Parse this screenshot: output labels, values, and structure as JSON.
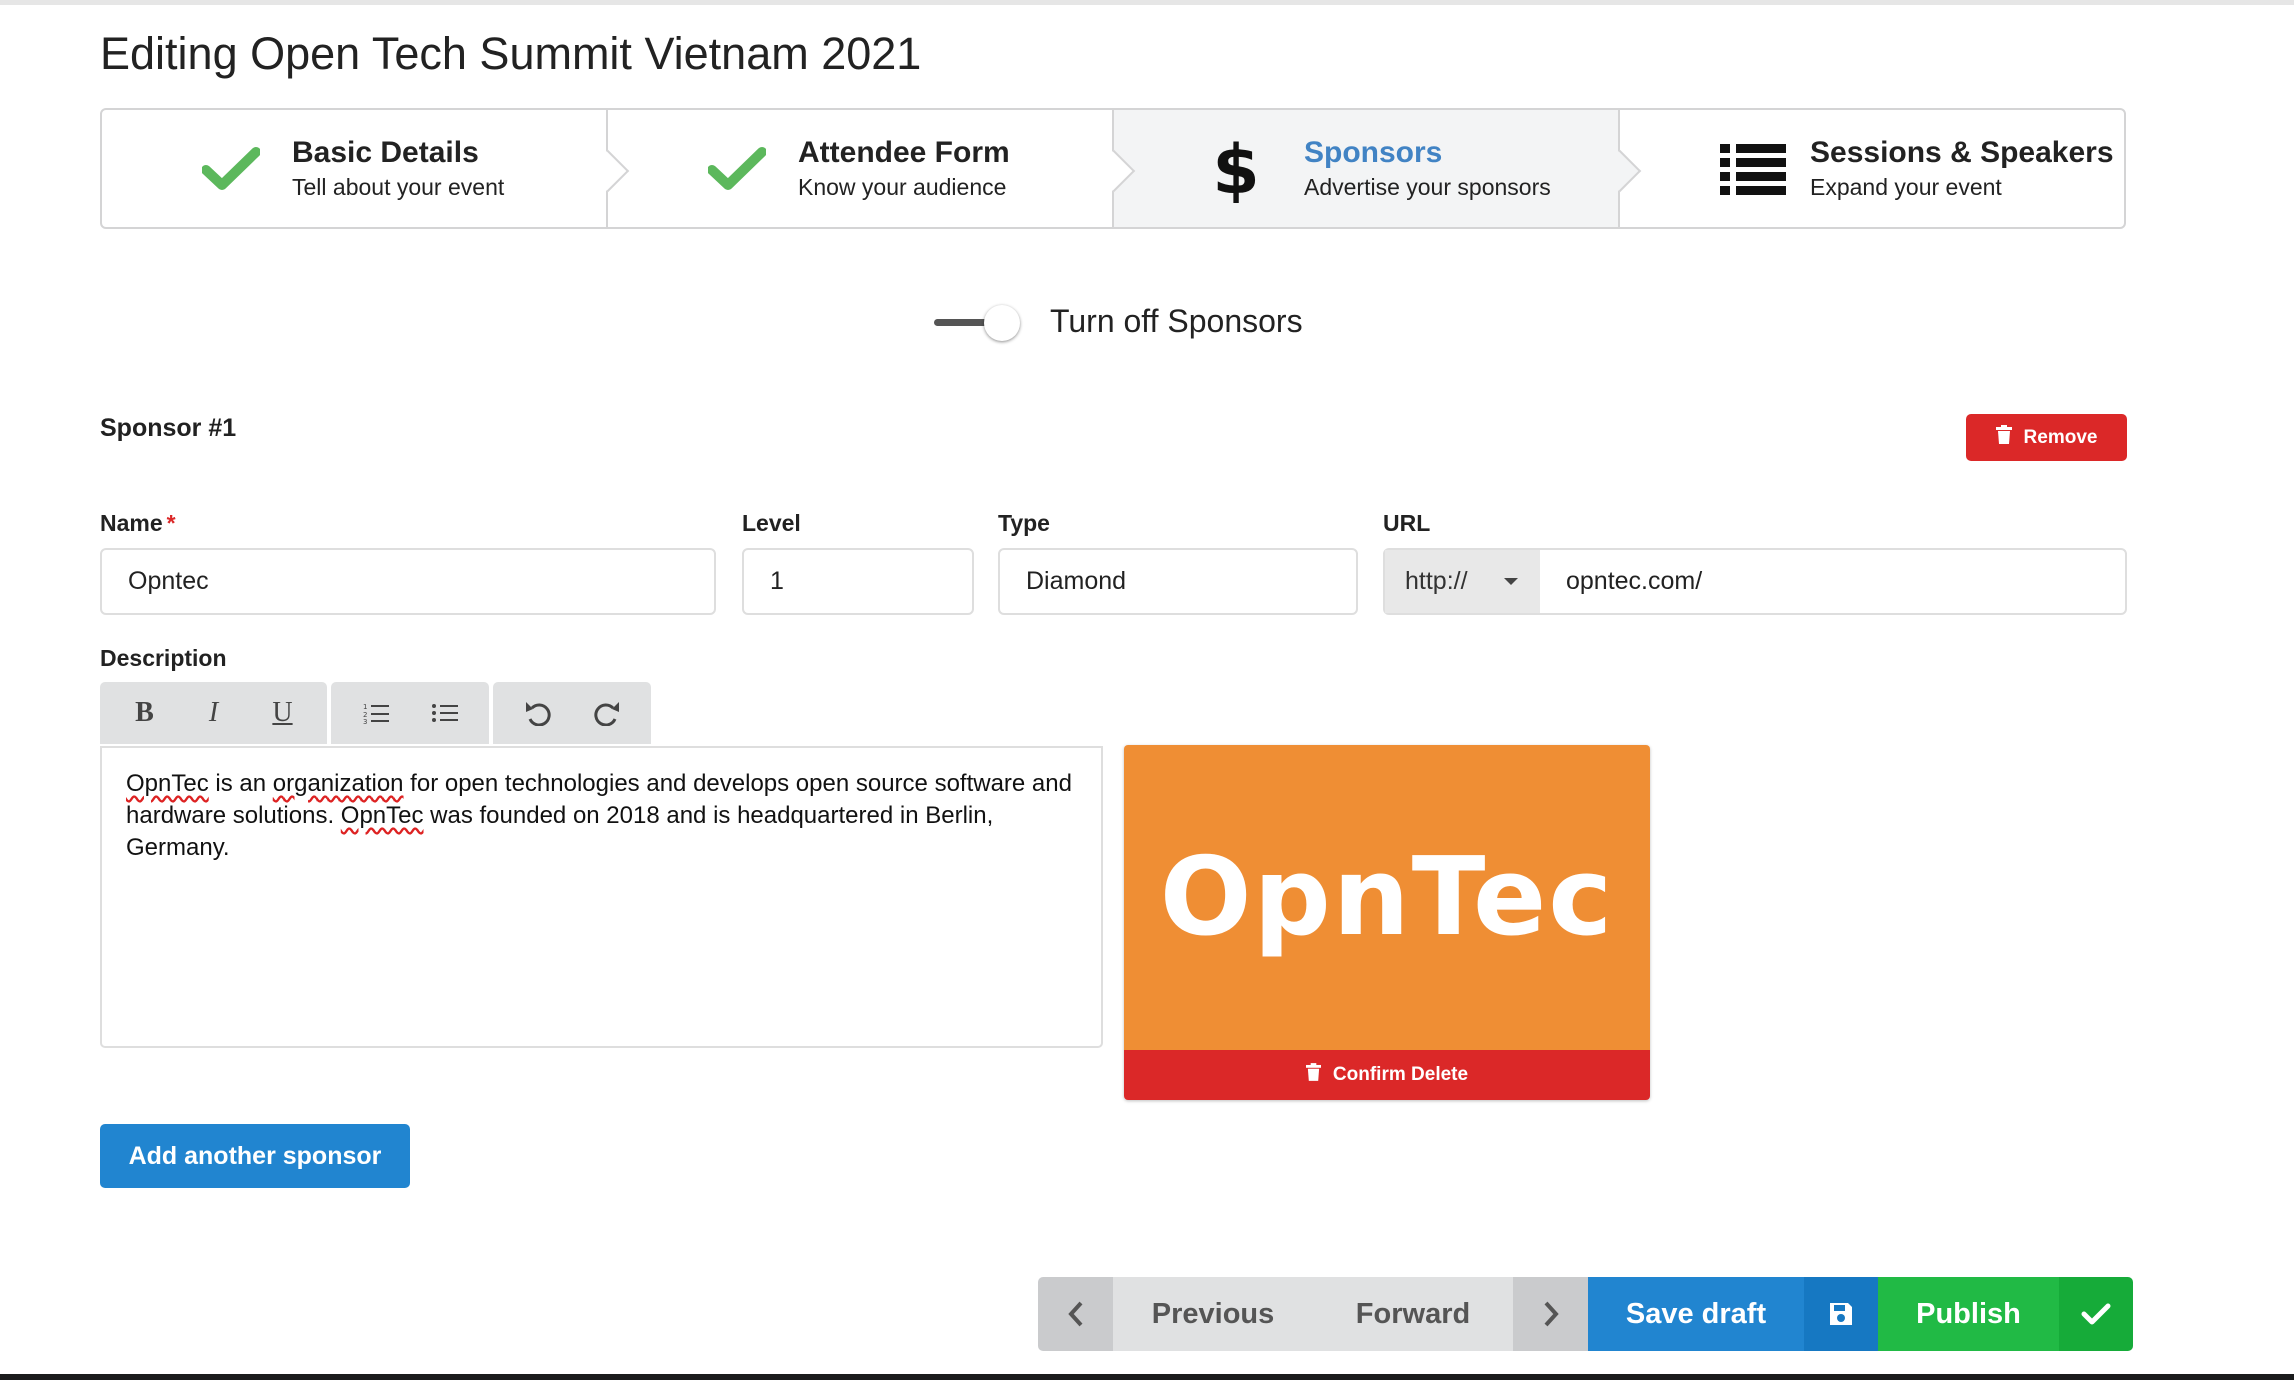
{
  "page": {
    "title": "Editing Open Tech Summit Vietnam 2021"
  },
  "steps": [
    {
      "title": "Basic Details",
      "description": "Tell about your event",
      "icon": "checkmark-icon",
      "status": "completed"
    },
    {
      "title": "Attendee Form",
      "description": "Know your audience",
      "icon": "checkmark-icon",
      "status": "completed"
    },
    {
      "title": "Sponsors",
      "description": "Advertise your sponsors",
      "icon": "dollar-icon",
      "status": "active"
    },
    {
      "title": "Sessions & Speakers",
      "description": "Expand your event",
      "icon": "list-icon",
      "status": "pending"
    }
  ],
  "toggle": {
    "label": "Turn off Sponsors",
    "checked": true
  },
  "sponsor": {
    "heading": "Sponsor #1",
    "remove_label": "Remove",
    "fields": {
      "name_label": "Name",
      "name_required": "*",
      "name_value": "Opntec",
      "level_label": "Level",
      "level_value": "1",
      "type_label": "Type",
      "type_value": "Diamond",
      "url_label": "URL",
      "url_protocol": "http://",
      "url_value": "opntec.com/"
    },
    "description_label": "Description",
    "description_parts": {
      "p1": "OpnTec",
      "p2": " is an ",
      "p3": "organization",
      "p4": " for open technologies and develops open source software and hardware solutions. ",
      "p5": "OpnTec",
      "p6": " was founded on 2018 and is headquartered in Berlin, Germany."
    },
    "logo_text": "OpnTec",
    "confirm_delete_label": "Confirm Delete"
  },
  "toolbar": {
    "bold": "B",
    "italic": "I",
    "underline": "U"
  },
  "add_sponsor_label": "Add another sponsor",
  "nav": {
    "previous_label": "Previous",
    "forward_label": "Forward",
    "save_draft_label": "Save draft",
    "publish_label": "Publish"
  },
  "colors": {
    "primary": "#2185d0",
    "danger": "#db2828",
    "success": "#21ba45",
    "check": "#5cb85c",
    "logo_bg": "#ef8e34",
    "active_step": "#4183c4"
  }
}
